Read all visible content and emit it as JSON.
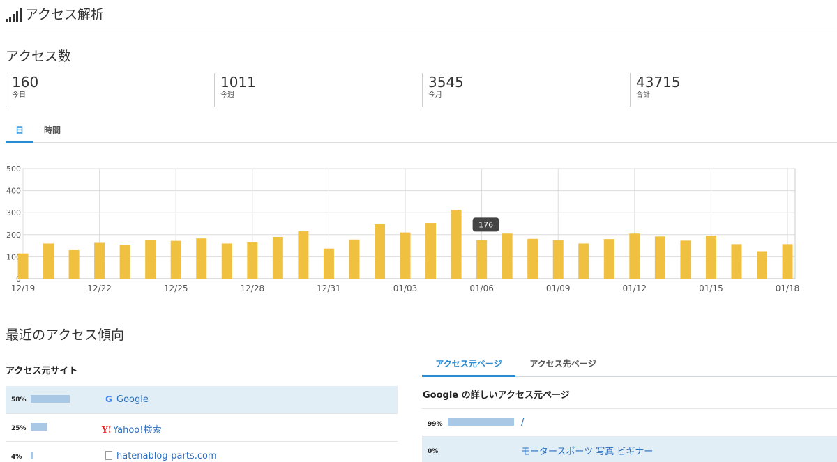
{
  "header": {
    "title": "アクセス解析"
  },
  "access_count": {
    "title": "アクセス数",
    "stats": [
      {
        "value": "160",
        "label": "今日"
      },
      {
        "value": "1011",
        "label": "今週"
      },
      {
        "value": "3545",
        "label": "今月"
      },
      {
        "value": "43715",
        "label": "合計"
      }
    ]
  },
  "tabs": {
    "day": "日",
    "hour": "時間"
  },
  "chart_data": {
    "type": "bar",
    "color": "#f0c040",
    "categories": [
      "12/19",
      "12/20",
      "12/21",
      "12/22",
      "12/23",
      "12/24",
      "12/25",
      "12/26",
      "12/27",
      "12/28",
      "12/29",
      "12/30",
      "12/31",
      "01/01",
      "01/02",
      "01/03",
      "01/04",
      "01/05",
      "01/06",
      "01/07",
      "01/08",
      "01/09",
      "01/10",
      "01/11",
      "01/12",
      "01/13",
      "01/14",
      "01/15",
      "01/16",
      "01/17",
      "01/18"
    ],
    "values": [
      115,
      160,
      130,
      163,
      155,
      177,
      172,
      183,
      160,
      165,
      190,
      215,
      137,
      178,
      247,
      210,
      253,
      313,
      176,
      205,
      181,
      176,
      160,
      180,
      205,
      192,
      173,
      196,
      157,
      125,
      157
    ],
    "x_tick_labels": [
      "12/19",
      "12/22",
      "12/25",
      "12/28",
      "12/31",
      "01/03",
      "01/06",
      "01/09",
      "01/12",
      "01/15",
      "01/18"
    ],
    "y_ticks": [
      "0",
      "100",
      "200",
      "300",
      "400",
      "500"
    ],
    "ylim": [
      0,
      500
    ],
    "tooltip": {
      "category": "01/06",
      "text": "176"
    },
    "grid": true
  },
  "recent": {
    "title": "最近のアクセス傾向"
  },
  "referrer_sites": {
    "title": "アクセス元サイト",
    "rows": [
      {
        "pct": "58%",
        "fraction": 0.58,
        "label": "Google",
        "icon": "google-icon"
      },
      {
        "pct": "25%",
        "fraction": 0.25,
        "label": "Yahoo!検索",
        "icon": "yahoo-icon"
      },
      {
        "pct": "4%",
        "fraction": 0.04,
        "label": "hatenablog-parts.com",
        "icon": "page-icon"
      }
    ]
  },
  "right_tabs": {
    "referrer_pages": "アクセス元ページ",
    "destination_pages": "アクセス先ページ"
  },
  "google_detail": {
    "title": "Google の詳しいアクセス元ページ",
    "rows": [
      {
        "pct": "99%",
        "fraction": 0.99,
        "label": "/"
      },
      {
        "pct": "0%",
        "fraction": 0.0,
        "label": "モータースポーツ 写真 ビギナー"
      }
    ]
  }
}
